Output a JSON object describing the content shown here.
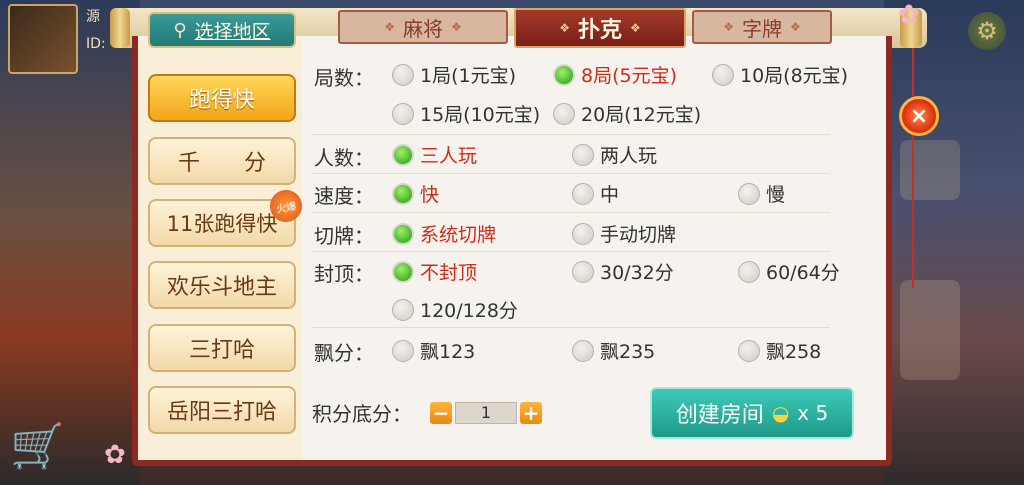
{
  "background": {
    "avatar_name": "源",
    "avatar_id": "ID:"
  },
  "region": {
    "label": "选择地区"
  },
  "game_tabs": [
    {
      "label": "麻将",
      "active": false
    },
    {
      "label": "扑克",
      "active": true
    },
    {
      "label": "字牌",
      "active": false
    }
  ],
  "sidebar": {
    "items": [
      {
        "label": "跑得快",
        "selected": true
      },
      {
        "label": "千　　分",
        "selected": false
      },
      {
        "label": "11张跑得快",
        "selected": false,
        "badge": "火爆"
      },
      {
        "label": "欢乐斗地主",
        "selected": false
      },
      {
        "label": "三打哈",
        "selected": false
      },
      {
        "label": "岳阳三打哈",
        "selected": false
      }
    ]
  },
  "options": {
    "rounds": {
      "label": "局数：",
      "choices": [
        "1局(1元宝)",
        "8局(5元宝)",
        "10局(8元宝)",
        "15局(10元宝)",
        "20局(12元宝)"
      ],
      "selected": "8局(5元宝)"
    },
    "players": {
      "label": "人数：",
      "choices": [
        "三人玩",
        "两人玩"
      ],
      "selected": "三人玩"
    },
    "speed": {
      "label": "速度：",
      "choices": [
        "快",
        "中",
        "慢"
      ],
      "selected": "快"
    },
    "cut": {
      "label": "切牌：",
      "choices": [
        "系统切牌",
        "手动切牌"
      ],
      "selected": "系统切牌"
    },
    "cap": {
      "label": "封顶：",
      "choices": [
        "不封顶",
        "30/32分",
        "60/64分",
        "120/128分"
      ],
      "selected": "不封顶"
    },
    "float": {
      "label": "飘分：",
      "choices": [
        "飘123",
        "飘235",
        "飘258"
      ],
      "selected": null
    }
  },
  "base_score": {
    "label": "积分底分：",
    "minus": "−",
    "plus": "+",
    "value": "1"
  },
  "create_button": {
    "label": "创建房间",
    "cost": "x 5"
  },
  "close_icon": "×",
  "colors": {
    "accent_red": "#8a2a22",
    "selected_text": "#d22a1a",
    "create_teal": "#2bb3a2",
    "sidebar_selected": "#f2a419"
  }
}
